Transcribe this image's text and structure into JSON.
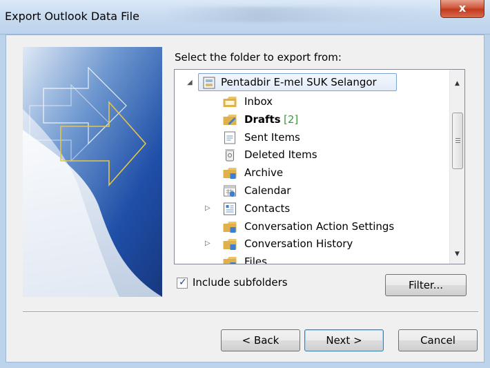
{
  "window": {
    "title": "Export Outlook Data File",
    "close_label": "x"
  },
  "content": {
    "select_label": "Select the folder to export from:"
  },
  "tree": {
    "root": {
      "label": "Pentadbir E-mel SUK Selangor",
      "icon": "mailbox-icon",
      "expanded": true
    },
    "items": [
      {
        "label": "Inbox",
        "icon": "inbox-folder-icon",
        "bold": false,
        "count": "",
        "expandable": false
      },
      {
        "label": "Drafts",
        "icon": "drafts-folder-icon",
        "bold": true,
        "count": "[2]",
        "expandable": false
      },
      {
        "label": "Sent Items",
        "icon": "sent-folder-icon",
        "bold": false,
        "count": "",
        "expandable": false
      },
      {
        "label": "Deleted Items",
        "icon": "trash-icon",
        "bold": false,
        "count": "",
        "expandable": false
      },
      {
        "label": "Archive",
        "icon": "archive-folder-icon",
        "bold": false,
        "count": "",
        "expandable": false
      },
      {
        "label": "Calendar",
        "icon": "calendar-icon",
        "bold": false,
        "count": "",
        "expandable": false
      },
      {
        "label": "Contacts",
        "icon": "contacts-icon",
        "bold": false,
        "count": "",
        "expandable": true
      },
      {
        "label": "Conversation Action Settings",
        "icon": "folder-icon",
        "bold": false,
        "count": "",
        "expandable": false
      },
      {
        "label": "Conversation History",
        "icon": "folder-icon",
        "bold": false,
        "count": "",
        "expandable": true
      },
      {
        "label": "Files",
        "icon": "folder-icon",
        "bold": false,
        "count": "",
        "expandable": false
      }
    ]
  },
  "options": {
    "include_subfolders_label": "Include subfolders",
    "include_subfolders_checked": true,
    "filter_label": "Filter..."
  },
  "buttons": {
    "back": "< Back",
    "next": "Next >",
    "cancel": "Cancel"
  },
  "colors": {
    "accent": "#3c7fb1",
    "count_green": "#3a9a3a",
    "close_red": "#c23a1e"
  }
}
